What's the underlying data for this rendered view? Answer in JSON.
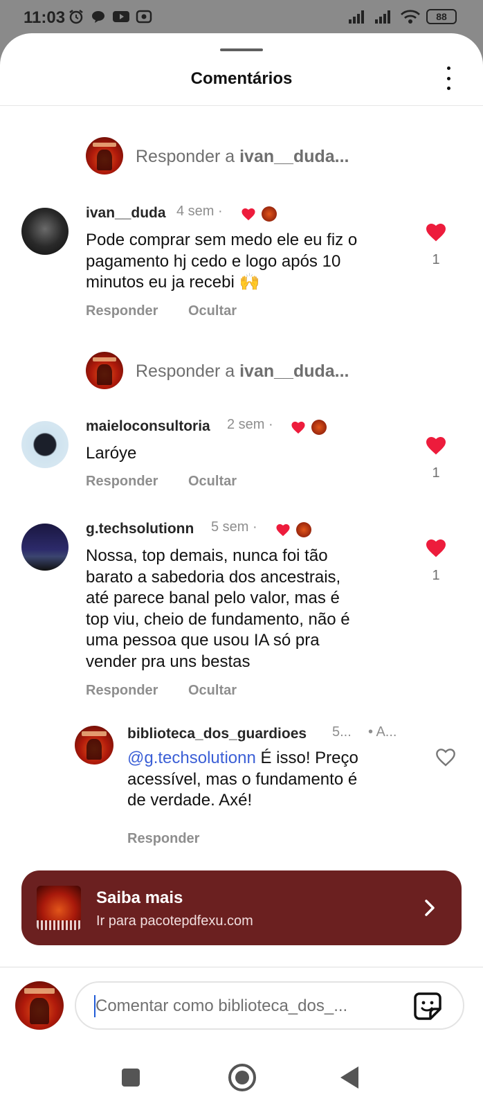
{
  "status_bar": {
    "time": "11:03",
    "battery": "88",
    "left_icons": [
      "alarm-icon",
      "chat-bubble-icon",
      "youtube-icon",
      "radio-icon"
    ],
    "right_icons": [
      "signal-icon",
      "signal-icon",
      "wifi-icon",
      "battery-icon"
    ]
  },
  "header": {
    "title": "Comentários",
    "more_icon": "more-vertical-icon"
  },
  "reply_prompts": [
    {
      "prefix": "Responder a ",
      "username": "ivan__duda..."
    },
    {
      "prefix": "Responder a ",
      "username": "ivan__duda..."
    }
  ],
  "comments": [
    {
      "username": "ivan__duda",
      "meta": "4 sem ·",
      "text_lines": [
        "Pode comprar sem medo ele eu fiz o",
        "pagamento hj cedo e logo após 10",
        "minutos eu ja recebi 🙌"
      ],
      "likes": "1",
      "liked": true,
      "actions": [
        "Responder",
        "Ocultar"
      ]
    },
    {
      "username": "maieloconsultoria",
      "meta": "2 sem ·",
      "text_lines": [
        "Laróye"
      ],
      "likes": "1",
      "liked": true,
      "actions": [
        "Responder",
        "Ocultar"
      ]
    },
    {
      "username": "g.techsolutionn",
      "meta": "5 sem ·",
      "text_lines": [
        "Nossa, top demais, nunca foi tão",
        "barato a sabedoria dos ancestrais,",
        "até parece banal pelo valor, mas é",
        "top viu, cheio de fundamento, não é",
        "uma pessoa que usou IA só pra",
        "vender pra uns bestas"
      ],
      "likes": "1",
      "liked": true,
      "actions": [
        "Responder",
        "Ocultar"
      ]
    }
  ],
  "reply": {
    "username": "biblioteca_dos_guardioes",
    "meta": "5...",
    "meta_tail": "• A...",
    "mention": "@g.techsolutionn",
    "text_first": " É isso! Preço",
    "text_lines": [
      "acessível, mas o fundamento é",
      "de verdade. Axé!"
    ],
    "liked": false,
    "action": "Responder"
  },
  "promo": {
    "title": "Saiba mais",
    "subtitle": "Ir para pacotepdfexu.com",
    "bg_color": "#6b2020"
  },
  "composer": {
    "placeholder": "Comentar como biblioteca_dos_...",
    "sticker_icon": "sticker-icon"
  },
  "colors": {
    "heart": "#ed1c3c",
    "mention": "#3b5fd6",
    "muted": "#8e8e8e"
  }
}
